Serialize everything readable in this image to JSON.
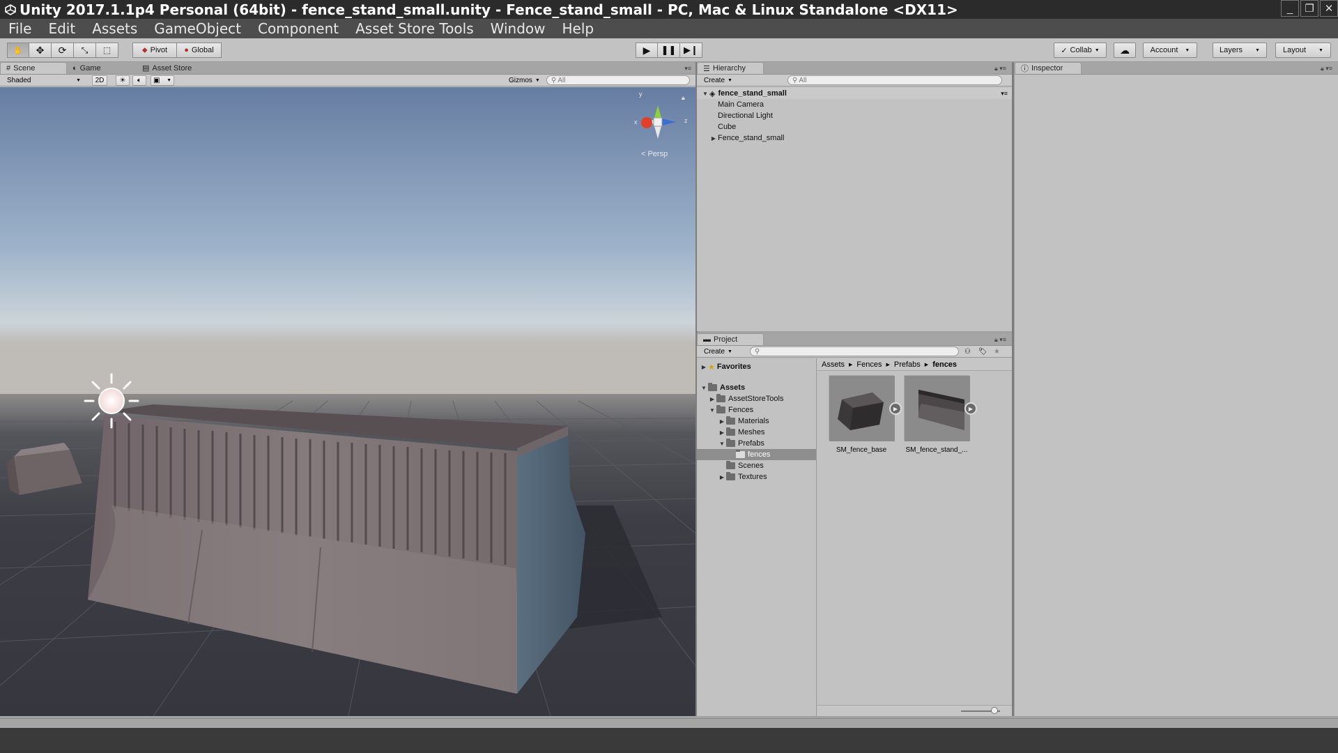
{
  "window": {
    "title": "Unity 2017.1.1p4 Personal (64bit) - fence_stand_small.unity - Fence_stand_small - PC, Mac & Linux Standalone <DX11>",
    "controls": [
      "_",
      "❐",
      "✕"
    ]
  },
  "menu": [
    "File",
    "Edit",
    "Assets",
    "GameObject",
    "Component",
    "Asset Store Tools",
    "Window",
    "Help"
  ],
  "toolbar": {
    "pivot_label": "Pivot",
    "global_label": "Global",
    "collab_label": "Collab",
    "account_label": "Account",
    "layers_label": "Layers",
    "layout_label": "Layout"
  },
  "scene_panel": {
    "tabs": [
      "Scene",
      "Game",
      "Asset Store"
    ],
    "shading_mode": "Shaded",
    "mode_2d": "2D",
    "gizmos_label": "Gizmos",
    "search_placeholder": "All",
    "projection_label": "Persp",
    "axis_labels": {
      "x": "x",
      "y": "y",
      "z": "z"
    }
  },
  "hierarchy": {
    "tab": "Hierarchy",
    "create_label": "Create",
    "search_placeholder": "All",
    "scene_name": "fence_stand_small",
    "items": [
      "Main Camera",
      "Directional Light",
      "Cube",
      "Fence_stand_small"
    ]
  },
  "project": {
    "tab": "Project",
    "create_label": "Create",
    "favorites_label": "Favorites",
    "assets_label": "Assets",
    "tree": {
      "asset_store_tools": "AssetStoreTools",
      "fences": "Fences",
      "materials": "Materials",
      "meshes": "Meshes",
      "prefabs": "Prefabs",
      "fences_sub": "fences",
      "scenes": "Scenes",
      "textures": "Textures"
    },
    "breadcrumb": [
      "Assets",
      "Fences",
      "Prefabs",
      "fences"
    ],
    "assets": [
      "SM_fence_base",
      "SM_fence_stand_..."
    ],
    "zoom_level": 0.85
  },
  "inspector": {
    "tab": "Inspector"
  },
  "colors": {
    "sky_top": "#6c83a6",
    "sky_horizon": "#c9d3da",
    "ground": "#3c3d44",
    "grid": "#56585f",
    "fence": "#7c6f72",
    "selection": "#8e8e8e"
  }
}
